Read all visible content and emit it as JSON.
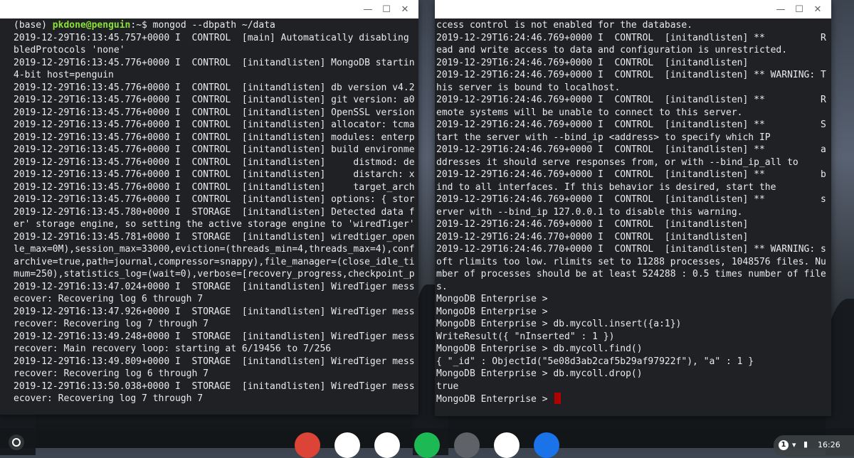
{
  "left_terminal": {
    "lines": [
      "(base) ",
      "2019-12-29T16:13:45.757+0000 I  CONTROL  [main] Automatically disabling",
      "bledProtocols 'none'",
      "2019-12-29T16:13:45.776+0000 I  CONTROL  [initandlisten] MongoDB startin",
      "4-bit host=penguin",
      "2019-12-29T16:13:45.776+0000 I  CONTROL  [initandlisten] db version v4.2",
      "2019-12-29T16:13:45.776+0000 I  CONTROL  [initandlisten] git version: a0",
      "2019-12-29T16:13:45.776+0000 I  CONTROL  [initandlisten] OpenSSL version",
      "2019-12-29T16:13:45.776+0000 I  CONTROL  [initandlisten] allocator: tcma",
      "2019-12-29T16:13:45.776+0000 I  CONTROL  [initandlisten] modules: enterp",
      "2019-12-29T16:13:45.776+0000 I  CONTROL  [initandlisten] build environme",
      "2019-12-29T16:13:45.776+0000 I  CONTROL  [initandlisten]     distmod: de",
      "2019-12-29T16:13:45.776+0000 I  CONTROL  [initandlisten]     distarch: x",
      "2019-12-29T16:13:45.776+0000 I  CONTROL  [initandlisten]     target_arch",
      "2019-12-29T16:13:45.776+0000 I  CONTROL  [initandlisten] options: { stor",
      "2019-12-29T16:13:45.780+0000 I  STORAGE  [initandlisten] Detected data f",
      "er' storage engine, so setting the active storage engine to 'wiredTiger'",
      "2019-12-29T16:13:45.781+0000 I  STORAGE  [initandlisten] wiredtiger_open",
      "le_max=0M),session_max=33000,eviction=(threads_min=4,threads_max=4),conf",
      "archive=true,path=journal,compressor=snappy),file_manager=(close_idle_ti",
      "mum=250),statistics_log=(wait=0),verbose=[recovery_progress,checkpoint_p",
      "2019-12-29T16:13:47.024+0000 I  STORAGE  [initandlisten] WiredTiger mess",
      "ecover: Recovering log 6 through 7",
      "2019-12-29T16:13:47.926+0000 I  STORAGE  [initandlisten] WiredTiger mess",
      "recover: Recovering log 7 through 7",
      "2019-12-29T16:13:49.248+0000 I  STORAGE  [initandlisten] WiredTiger mess",
      "recover: Main recovery loop: starting at 6/19456 to 7/256",
      "2019-12-29T16:13:49.809+0000 I  STORAGE  [initandlisten] WiredTiger mess",
      "recover: Recovering log 6 through 7",
      "2019-12-29T16:13:50.038+0000 I  STORAGE  [initandlisten] WiredTiger mess",
      "ecover: Recovering log 7 through 7"
    ],
    "prompt_user": "pkdone@penguin",
    "prompt_rest": ":~$ mongod --dbpath ~/data"
  },
  "right_terminal": {
    "lines": [
      "ccess control is not enabled for the database.",
      "2019-12-29T16:24:46.769+0000 I  CONTROL  [initandlisten] **          R",
      "ead and write access to data and configuration is unrestricted.",
      "2019-12-29T16:24:46.769+0000 I  CONTROL  [initandlisten]",
      "2019-12-29T16:24:46.769+0000 I  CONTROL  [initandlisten] ** WARNING: T",
      "his server is bound to localhost.",
      "2019-12-29T16:24:46.769+0000 I  CONTROL  [initandlisten] **          R",
      "emote systems will be unable to connect to this server.",
      "2019-12-29T16:24:46.769+0000 I  CONTROL  [initandlisten] **          S",
      "tart the server with --bind_ip <address> to specify which IP",
      "2019-12-29T16:24:46.769+0000 I  CONTROL  [initandlisten] **          a",
      "ddresses it should serve responses from, or with --bind_ip_all to",
      "2019-12-29T16:24:46.769+0000 I  CONTROL  [initandlisten] **          b",
      "ind to all interfaces. If this behavior is desired, start the",
      "2019-12-29T16:24:46.769+0000 I  CONTROL  [initandlisten] **          s",
      "erver with --bind_ip 127.0.0.1 to disable this warning.",
      "2019-12-29T16:24:46.769+0000 I  CONTROL  [initandlisten]",
      "2019-12-29T16:24:46.770+0000 I  CONTROL  [initandlisten]",
      "2019-12-29T16:24:46.770+0000 I  CONTROL  [initandlisten] ** WARNING: s",
      "oft rlimits too low. rlimits set to 11288 processes, 1048576 files. Nu",
      "mber of processes should be at least 524288 : 0.5 times number of file",
      "s.",
      "MongoDB Enterprise >",
      "MongoDB Enterprise >",
      "MongoDB Enterprise > db.mycoll.insert({a:1})",
      "WriteResult({ \"nInserted\" : 1 })",
      "MongoDB Enterprise > db.mycoll.find()",
      "{ \"_id\" : ObjectId(\"5e08d3ab2caf5b29af97922f\"), \"a\" : 1 }",
      "MongoDB Enterprise > db.mycoll.drop()",
      "true",
      "MongoDB Enterprise > "
    ]
  },
  "window_controls": {
    "minimize": "—",
    "maximize": "☐",
    "close": "✕"
  },
  "shelf": {
    "apps": [
      {
        "name": "chrome-icon",
        "color": "#db4437"
      },
      {
        "name": "gmail-icon",
        "color": "#ffffff"
      },
      {
        "name": "play-store-icon",
        "color": "#ffffff"
      },
      {
        "name": "spotify-icon",
        "color": "#1db954"
      },
      {
        "name": "terminal-icon",
        "color": "#5f6368"
      },
      {
        "name": "keep-icon",
        "color": "#ffffff"
      },
      {
        "name": "files-icon",
        "color": "#1a73e8"
      }
    ],
    "status": {
      "notifications": "1",
      "clock": "16:26"
    }
  }
}
